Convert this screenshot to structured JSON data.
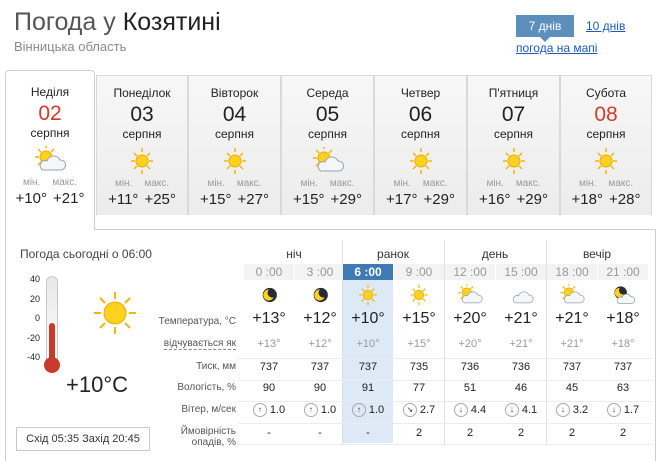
{
  "header": {
    "title_prefix": "Погода у ",
    "city": "Козятині",
    "region": "Вінницька область",
    "tab_7": "7 днів",
    "tab_10": "10 днів",
    "map_link": "погода на мапі"
  },
  "days": [
    {
      "name": "Неділя",
      "num": "02",
      "month": "серпня",
      "icon": "partly-cloudy-icon",
      "min_label": "мін.",
      "max_label": "макс.",
      "min": "+10°",
      "max": "+21°",
      "weekend": true,
      "active": true
    },
    {
      "name": "Понеділок",
      "num": "03",
      "month": "серпня",
      "icon": "sun-icon",
      "min_label": "мін.",
      "max_label": "макс.",
      "min": "+11°",
      "max": "+25°",
      "weekend": false,
      "active": false
    },
    {
      "name": "Вівторок",
      "num": "04",
      "month": "серпня",
      "icon": "sun-icon",
      "min_label": "мін.",
      "max_label": "макс.",
      "min": "+15°",
      "max": "+27°",
      "weekend": false,
      "active": false
    },
    {
      "name": "Середа",
      "num": "05",
      "month": "серпня",
      "icon": "partly-cloudy-icon",
      "min_label": "мін.",
      "max_label": "макс.",
      "min": "+15°",
      "max": "+29°",
      "weekend": false,
      "active": false
    },
    {
      "name": "Четвер",
      "num": "06",
      "month": "серпня",
      "icon": "sun-icon",
      "min_label": "мін.",
      "max_label": "макс.",
      "min": "+17°",
      "max": "+29°",
      "weekend": false,
      "active": false
    },
    {
      "name": "П'ятниця",
      "num": "07",
      "month": "серпня",
      "icon": "sun-icon",
      "min_label": "мін.",
      "max_label": "макс.",
      "min": "+16°",
      "max": "+29°",
      "weekend": false,
      "active": false
    },
    {
      "name": "Субота",
      "num": "08",
      "month": "серпня",
      "icon": "sun-icon",
      "min_label": "мін.",
      "max_label": "макс.",
      "min": "+18°",
      "max": "+28°",
      "weekend": true,
      "active": false
    }
  ],
  "now": {
    "label": "Погода сьогодні о 06:00",
    "temp": "+10°C",
    "scale": [
      "40",
      "20",
      "0",
      "-20",
      "-40"
    ],
    "thermo_level": 0.5,
    "sunrise_sunset": "Схід 05:35 Захід 20:45"
  },
  "periods": [
    "ніч",
    "ранок",
    "день",
    "вечір"
  ],
  "hours": [
    "0 :00",
    "3 :00",
    "6 :00",
    "9 :00",
    "12 :00",
    "15 :00",
    "18 :00",
    "21 :00"
  ],
  "active_hour": 2,
  "row_labels": {
    "temp": "Температура, °C",
    "feels": "відчувається як",
    "pressure": "Тиск, мм",
    "humidity": "Вологість, %",
    "wind": "Вітер, м/сек",
    "precip_1": "Ймовірність",
    "precip_2": "опадів, %"
  },
  "hourly": [
    {
      "icon": "moon-icon",
      "temp": "+13°",
      "feels": "+13°",
      "pressure": "737",
      "humidity": "90",
      "wind_dir": "↑",
      "wind": "1.0",
      "precip": "-"
    },
    {
      "icon": "moon-icon",
      "temp": "+12°",
      "feels": "+12°",
      "pressure": "737",
      "humidity": "90",
      "wind_dir": "↑",
      "wind": "1.0",
      "precip": "-"
    },
    {
      "icon": "sun-icon",
      "temp": "+10°",
      "feels": "+10°",
      "pressure": "737",
      "humidity": "91",
      "wind_dir": "↑",
      "wind": "1.0",
      "precip": "-"
    },
    {
      "icon": "sun-icon",
      "temp": "+15°",
      "feels": "+15°",
      "pressure": "735",
      "humidity": "77",
      "wind_dir": "↘",
      "wind": "2.7",
      "precip": "2"
    },
    {
      "icon": "partly-cloudy-icon",
      "temp": "+20°",
      "feels": "+20°",
      "pressure": "736",
      "humidity": "51",
      "wind_dir": "↓",
      "wind": "4.4",
      "precip": "2"
    },
    {
      "icon": "cloud-icon",
      "temp": "+21°",
      "feels": "+21°",
      "pressure": "736",
      "humidity": "46",
      "wind_dir": "↓",
      "wind": "4.1",
      "precip": "2"
    },
    {
      "icon": "partly-cloudy-icon",
      "temp": "+21°",
      "feels": "+21°",
      "pressure": "737",
      "humidity": "45",
      "wind_dir": "↓",
      "wind": "3.2",
      "precip": "2"
    },
    {
      "icon": "cloudy-night-icon",
      "temp": "+18°",
      "feels": "+18°",
      "pressure": "737",
      "humidity": "63",
      "wind_dir": "↓",
      "wind": "1.7",
      "precip": "2"
    }
  ],
  "colors": {
    "accent": "#5d8fbd",
    "active_hour": "#3f7ab5",
    "highlight": "#dde9f6",
    "weekend": "#d23a2a",
    "thermo": "#c73a2c"
  }
}
